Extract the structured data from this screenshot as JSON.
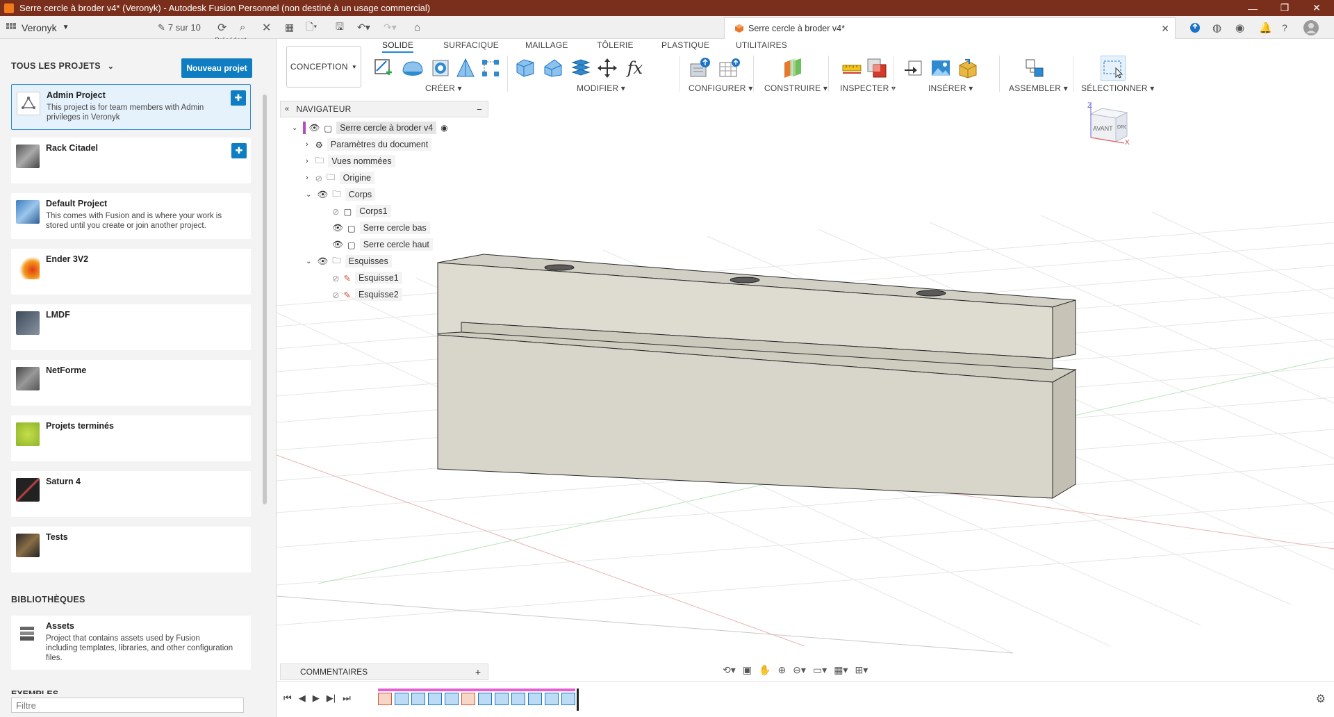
{
  "titlebar": {
    "title": "Serre cercle à broder v4* (Veronyk) - Autodesk Fusion Personnel (non destiné à un usage commercial)",
    "minimize": "—",
    "maximize": "❐",
    "close": "✕"
  },
  "appbar": {
    "user": "Veronyk",
    "versions": "7 sur 10",
    "precedent": "Précédent ›",
    "doc_tab_title": "Serre cercle à broder v4*"
  },
  "projects_panel": {
    "header": "TOUS LES PROJETS",
    "new_button": "Nouveau projet",
    "projects": [
      {
        "title": "Admin Project",
        "desc": "This project is for team members with Admin privileges in Veronyk"
      },
      {
        "title": "Rack Citadel",
        "desc": ""
      },
      {
        "title": "Default Project",
        "desc": "This comes with Fusion and is where your work is stored until you create or join another project."
      },
      {
        "title": "Ender 3V2",
        "desc": ""
      },
      {
        "title": "LMDF",
        "desc": ""
      },
      {
        "title": "NetForme",
        "desc": ""
      },
      {
        "title": "Projets terminés",
        "desc": ""
      },
      {
        "title": "Saturn 4",
        "desc": ""
      },
      {
        "title": "Tests",
        "desc": ""
      }
    ],
    "libraries_header": "BIBLIOTHÈQUES",
    "assets": {
      "title": "Assets",
      "desc": "Project that contains assets used by Fusion including templates, libraries, and other configuration files."
    },
    "examples_header": "EXEMPLES",
    "filter_placeholder": "Filtre"
  },
  "toolbar": {
    "workspace": "CONCEPTION",
    "tabs": [
      "SOLIDE",
      "SURFACIQUE",
      "MAILLAGE",
      "TÔLERIE",
      "PLASTIQUE",
      "UTILITAIRES"
    ],
    "groups": [
      "CRÉER",
      "MODIFIER",
      "CONFIGURER",
      "CONSTRUIRE",
      "INSPECTER",
      "INSÉRER",
      "ASSEMBLER",
      "SÉLECTIONNER"
    ]
  },
  "navigator": {
    "header": "NAVIGATEUR",
    "root": "Serre cercle à broder v4",
    "items": [
      "Paramètres du document",
      "Vues nommées",
      "Origine",
      "Corps",
      "Corps1",
      "Serre cercle bas",
      "Serre cercle haut",
      "Esquisses",
      "Esquisse1",
      "Esquisse2"
    ]
  },
  "viewcube": {
    "front": "AVANT",
    "right": "DROITE",
    "z": "Z",
    "x": "X"
  },
  "comments": {
    "label": "COMMENTAIRES"
  },
  "colors": {
    "accent": "#0f7dc2",
    "titlebar": "#7a2f1c"
  }
}
